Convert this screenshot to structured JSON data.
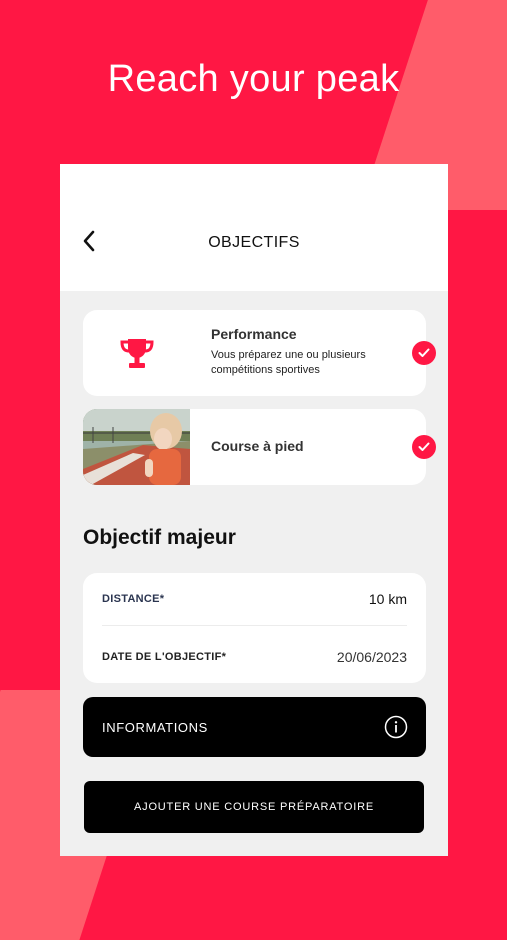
{
  "headline": "Reach your peak",
  "nav": {
    "title": "OBJECTIFS",
    "back_icon": "chevron-left-icon"
  },
  "goals": [
    {
      "title": "Performance",
      "description": "Vous préparez une ou plusieurs compétitions sportives",
      "icon": "trophy-icon",
      "selected": true
    },
    {
      "title": "Course à pied",
      "icon": "running-photo",
      "selected": true
    }
  ],
  "major_goal": {
    "title": "Objectif majeur",
    "fields": [
      {
        "label": "DISTANCE*",
        "value": "10 km"
      },
      {
        "label": "DATE DE L'OBJECTIF*",
        "value": "20/06/2023"
      }
    ]
  },
  "informations_button": {
    "label": "INFORMATIONS",
    "icon": "info-icon"
  },
  "add_race_button": {
    "label": "AJOUTER UNE COURSE PRÉPARATOIRE"
  },
  "colors": {
    "accent": "#ff1744",
    "accent_light": "#ff5c6a",
    "dark": "#000000"
  }
}
